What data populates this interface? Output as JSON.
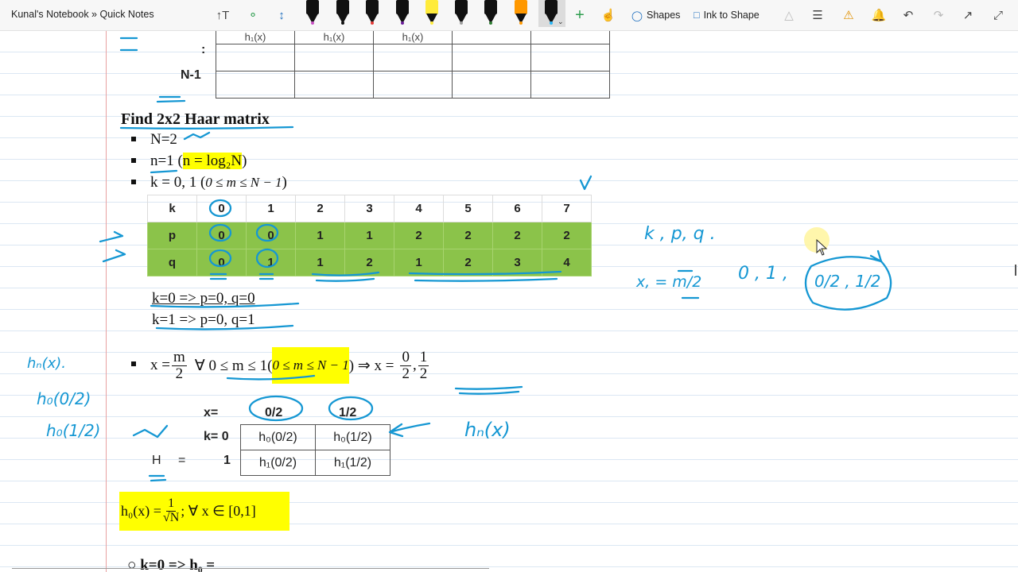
{
  "app": {
    "breadcrumb": "Kunal's Notebook » Quick Notes",
    "toolbar": {
      "shapes_label": "Shapes",
      "ink_to_shape_label": "Ink to Shape",
      "pens": [
        "#c84fc4",
        "#111111",
        "#e53935",
        "#6a1b9a",
        "#ffeb3b",
        "#9e9e9e",
        "#2e7d32",
        "#ff9800",
        "#29b6f6"
      ]
    }
  },
  "top_table": {
    "partial_row": [
      "h₁(x)",
      "h₁(x)",
      "h₁(x)"
    ],
    "row_labels": [
      ":",
      "N-1"
    ]
  },
  "content": {
    "heading": "Find 2x2 Haar matrix",
    "bullet1": "N=2",
    "bullet2_prefix": "n=1 (",
    "bullet2_highlight": "n = log₂N",
    "bullet2_suffix": ")",
    "bullet3": "k = 0, 1 (",
    "bullet3_ital": "0 ≤ m ≤ N − 1",
    "bullet3_suffix": ")",
    "kpq": {
      "row_k": [
        "k",
        "0",
        "1",
        "2",
        "3",
        "4",
        "5",
        "6",
        "7"
      ],
      "row_p": [
        "p",
        "0",
        "0",
        "1",
        "1",
        "2",
        "2",
        "2",
        "2"
      ],
      "row_q": [
        "q",
        "0",
        "1",
        "1",
        "2",
        "1",
        "2",
        "3",
        "4"
      ]
    },
    "mapping1": "k=0 => p=0, q=0",
    "mapping2": "k=1 => p=0, q=1",
    "x_formula": {
      "lhs": "x =",
      "num": "m",
      "den": "2",
      "forall": "∀ 0 ≤ m ≤ 1(",
      "highlight": "0 ≤ m ≤ N − 1",
      "implies": ") ⇒ x =",
      "v1_num": "0",
      "v1_den": "2",
      "comma": ",",
      "v2_num": "1",
      "v2_den": "2"
    },
    "h_table": {
      "x_label": "x=",
      "col_labels": [
        "0/2",
        "1/2"
      ],
      "k_label": "k= 0",
      "k1_label": "1",
      "H_label": "H",
      "eq": "=",
      "rows": [
        [
          "h₀(0/2)",
          "h₀(1/2)"
        ],
        [
          "h₁(0/2)",
          "h₁(1/2)"
        ]
      ]
    },
    "formula_box": {
      "lhs": "h₀(x) =",
      "num": "1",
      "den": "√N",
      "rhs": "; ∀ x ∈ [0,1]"
    },
    "bottom_line": "k=0 => h₀ ="
  },
  "handwriting": {
    "kpq_note": "k , p, q .",
    "x_note_lhs": "x, = m/2",
    "values_note": "0 , 1 ,",
    "circled_values": "0/2 , 1/2",
    "hn_note": "hₙ(x)",
    "left_notes": [
      "hₙ(x).",
      "h₀(0/2)",
      "h₀(1/2)"
    ]
  }
}
